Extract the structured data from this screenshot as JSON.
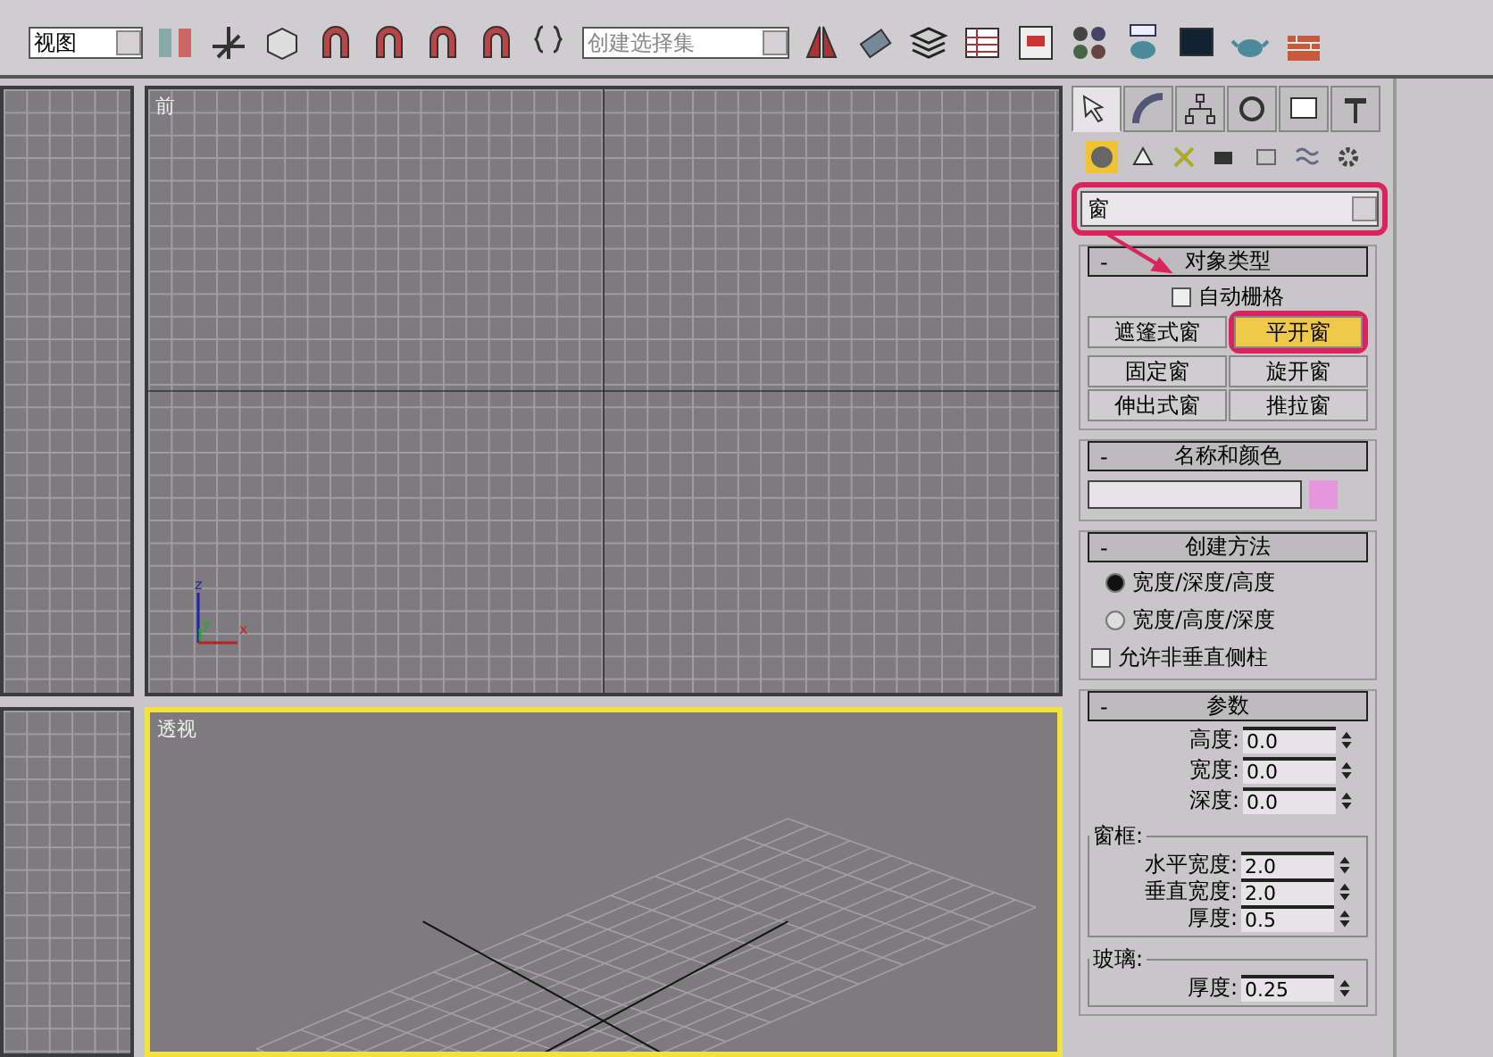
{
  "toolbar": {
    "view_dropdown": "视图",
    "selection_set_dropdown": {
      "placeholder": "创建选择集"
    }
  },
  "viewports": {
    "left_column": [
      {
        "active": false
      },
      {
        "active": false
      }
    ],
    "main": [
      {
        "kind": "ortho",
        "label": "前",
        "active": false,
        "axis_labels": [
          "z",
          "y",
          "x"
        ]
      },
      {
        "kind": "perspective",
        "label": "透视",
        "active": true
      }
    ]
  },
  "command_panel": {
    "tabs": [
      {
        "selected": true
      },
      {
        "selected": false
      },
      {
        "selected": false
      },
      {
        "selected": false
      },
      {
        "selected": false
      },
      {
        "selected": false
      }
    ],
    "category_icons": [
      {
        "selected": true
      },
      {
        "selected": false
      },
      {
        "selected": false
      },
      {
        "selected": false
      },
      {
        "selected": false
      },
      {
        "selected": false
      },
      {
        "selected": false
      }
    ],
    "category_dropdown": "窗",
    "rollouts": [
      {
        "kind": "object_type",
        "sign": "-",
        "title": "对象类型",
        "auto_grid": {
          "label": "自动栅格",
          "checked": false
        },
        "buttons": [
          {
            "label": "遮篷式窗",
            "selected": false
          },
          {
            "label": "平开窗",
            "selected": true
          },
          {
            "label": "固定窗",
            "selected": false
          },
          {
            "label": "旋开窗",
            "selected": false
          },
          {
            "label": "伸出式窗",
            "selected": false
          },
          {
            "label": "推拉窗",
            "selected": false
          }
        ]
      },
      {
        "kind": "name_color",
        "sign": "-",
        "title": "名称和颜色",
        "color": "#e696dc"
      },
      {
        "kind": "creation_method",
        "sign": "-",
        "title": "创建方法",
        "options": [
          {
            "label": "宽度/深度/高度",
            "selected": true
          },
          {
            "label": "宽度/高度/深度",
            "selected": false
          }
        ],
        "checkbox": {
          "label": "允许非垂直侧柱",
          "checked": false
        }
      },
      {
        "kind": "parameters",
        "sign": "-",
        "title": "参数",
        "fields": [
          {
            "label": "高度:",
            "value": "0.0"
          },
          {
            "label": "宽度:",
            "value": "0.0"
          },
          {
            "label": "深度:",
            "value": "0.0"
          }
        ],
        "groups": [
          {
            "title": "窗框:",
            "fields": [
              {
                "label": "水平宽度:",
                "value": "2.0"
              },
              {
                "label": "垂直宽度:",
                "value": "2.0"
              },
              {
                "label": "厚度:",
                "value": "0.5"
              }
            ]
          },
          {
            "title": "玻璃:",
            "fields": [
              {
                "label": "厚度:",
                "value": "0.25"
              }
            ]
          }
        ]
      }
    ]
  }
}
